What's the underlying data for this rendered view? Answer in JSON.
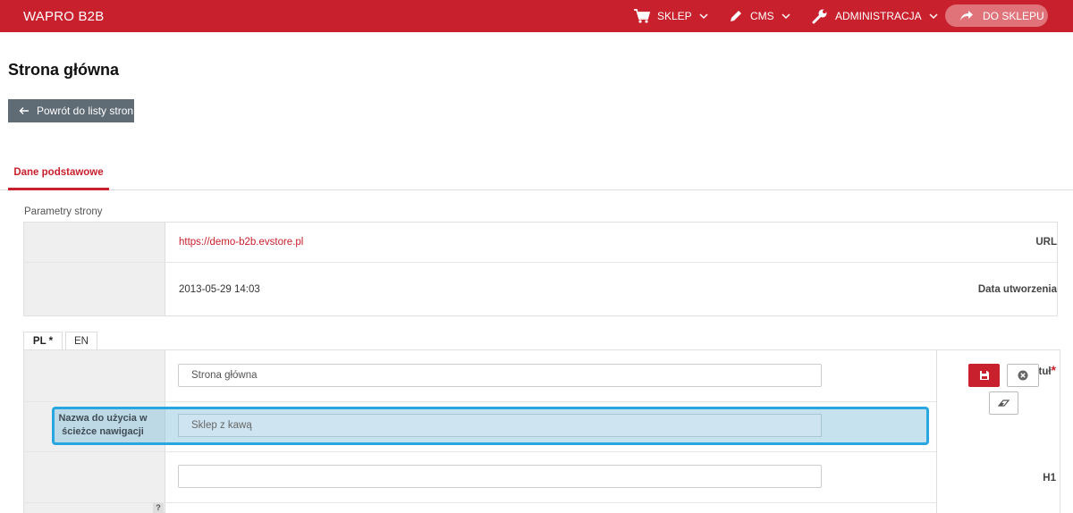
{
  "app": {
    "brand": "WAPRO B2B"
  },
  "nav": {
    "shop": "SKLEP",
    "cms": "CMS",
    "admin": "ADMINISTRACJA",
    "to_shop": "DO SKLEPU"
  },
  "page": {
    "title": "Strona główna",
    "back_button": "Powrót do listy stron"
  },
  "tabs": {
    "basic": "Dane podstawowe"
  },
  "params": {
    "section_label": "Parametry strony",
    "url_label": "URL",
    "url_value": "https://demo-b2b.evstore.pl",
    "created_label": "Data utworzenia",
    "created_value": "2013-05-29 14:03"
  },
  "lang_tabs": {
    "pl": "PL *",
    "en": "EN"
  },
  "form": {
    "title_label": "Tytuł",
    "title_required": "*",
    "title_value": "Strona główna",
    "breadcrumb_label": "Nazwa do użycia w ścieżce nawigacji",
    "breadcrumb_value": "Sklep z kawą",
    "h1_label": "H1",
    "h1_value": "",
    "help_badge": "?"
  },
  "colors": {
    "accent": "#c8202d",
    "highlight": "#27a6df",
    "back_button": "#5f6b75"
  }
}
